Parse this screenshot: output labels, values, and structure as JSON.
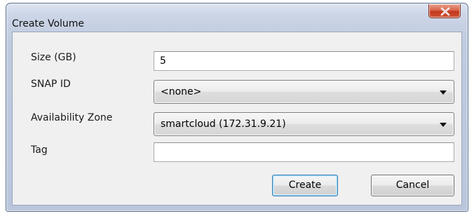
{
  "dialog": {
    "title": "Create Volume",
    "close_icon": "close-x-icon"
  },
  "form": {
    "size_label": "Size (GB)",
    "size_value": "5",
    "snap_label": "SNAP ID",
    "snap_value": "<none>",
    "zone_label": "Availability Zone",
    "zone_value": "smartcloud (172.31.9.21)",
    "tag_label": "Tag",
    "tag_value": ""
  },
  "buttons": {
    "create": "Create",
    "cancel": "Cancel"
  },
  "colors": {
    "title_bar": "#c7d1e3",
    "close_button": "#c2371c",
    "client_background": "#f0f0f0",
    "default_button_border": "#3c7fb1"
  }
}
